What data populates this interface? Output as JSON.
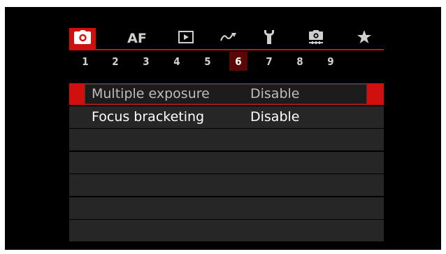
{
  "tabs": [
    {
      "id": "shooting",
      "icon": "camera-icon",
      "active": true
    },
    {
      "id": "af",
      "label": "AF",
      "active": false
    },
    {
      "id": "playback",
      "icon": "playback-icon",
      "active": false
    },
    {
      "id": "custom-functions",
      "icon": "wave-icon",
      "active": false
    },
    {
      "id": "setup",
      "icon": "wrench-icon",
      "active": false
    },
    {
      "id": "custom-mode",
      "icon": "camera-person-icon",
      "active": false
    },
    {
      "id": "my-menu",
      "icon": "star-icon",
      "active": false
    }
  ],
  "pages": [
    "1",
    "2",
    "3",
    "4",
    "5",
    "6",
    "7",
    "8",
    "9"
  ],
  "active_page": "6",
  "menu": {
    "items": [
      {
        "label": "Multiple exposure",
        "value": "Disable",
        "selected": true
      },
      {
        "label": "Focus bracketing",
        "value": "Disable",
        "selected": false
      }
    ],
    "empty_rows": 5
  },
  "colors": {
    "accent": "#d0100e",
    "active_page": "#5a0705",
    "row": "#262626",
    "background": "#000000"
  }
}
